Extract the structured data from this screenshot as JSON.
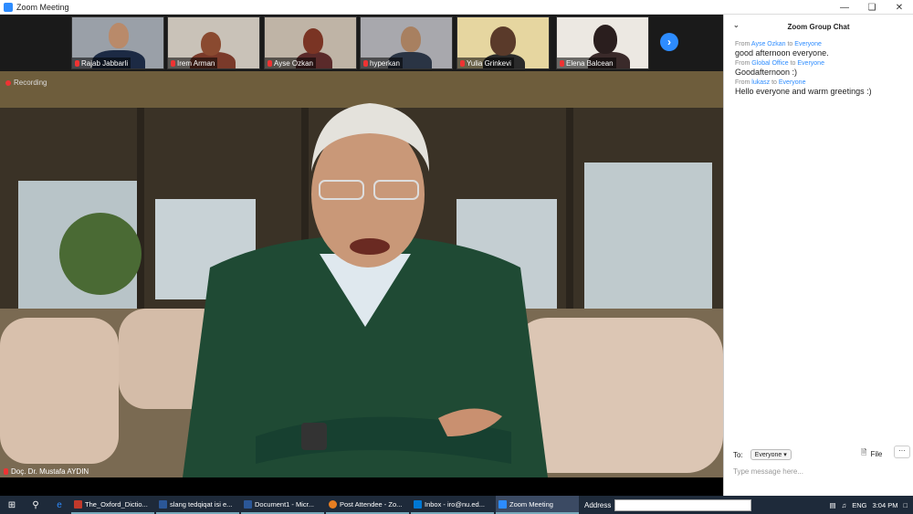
{
  "window": {
    "title": "Zoom Meeting"
  },
  "gallery": {
    "participants": [
      {
        "name": "Rajab Jabbarli"
      },
      {
        "name": "Irem Arman"
      },
      {
        "name": "Aysе Ozkan"
      },
      {
        "name": "hyperkan"
      },
      {
        "name": "Yulia Grinkevi"
      },
      {
        "name": "Elena Balcean"
      }
    ]
  },
  "video": {
    "recording_label": "Recording",
    "speaker_name": "Doç. Dr. Mustafa AYDIN"
  },
  "chat": {
    "title": "Zoom Group Chat",
    "messages": [
      {
        "from_prefix": "From",
        "sender": "Ayse Ozkan",
        "to_word": "to",
        "recipient": "Everyone",
        "text": "good afternoon everyone."
      },
      {
        "from_prefix": "From",
        "sender": "Global Office",
        "to_word": "to",
        "recipient": "Everyone",
        "text": "Goodafternoon :)"
      },
      {
        "from_prefix": "From",
        "sender": "lukasz",
        "to_word": "to",
        "recipient": "Everyone",
        "text": "Hello everyone and warm greetings :)"
      }
    ],
    "to_label": "To:",
    "to_value": "Everyone",
    "file_label": "File",
    "input_placeholder": "Type message here..."
  },
  "taskbar": {
    "apps": [
      {
        "label": "The_Oxford_Dictio...",
        "color": "#c0392b"
      },
      {
        "label": "slang tedqiqat isi e...",
        "color": "#2b5797"
      },
      {
        "label": "Document1 - Micr...",
        "color": "#2b5797"
      },
      {
        "label": "Post Attendee - Zo...",
        "color": "#e67e22"
      },
      {
        "label": "Inbox - iro@nu.ed...",
        "color": "#0078d4"
      },
      {
        "label": "Zoom Meeting",
        "color": "#2d8cff"
      }
    ],
    "address_label": "Address",
    "lang": "ENG",
    "time": "3:04 PM"
  }
}
